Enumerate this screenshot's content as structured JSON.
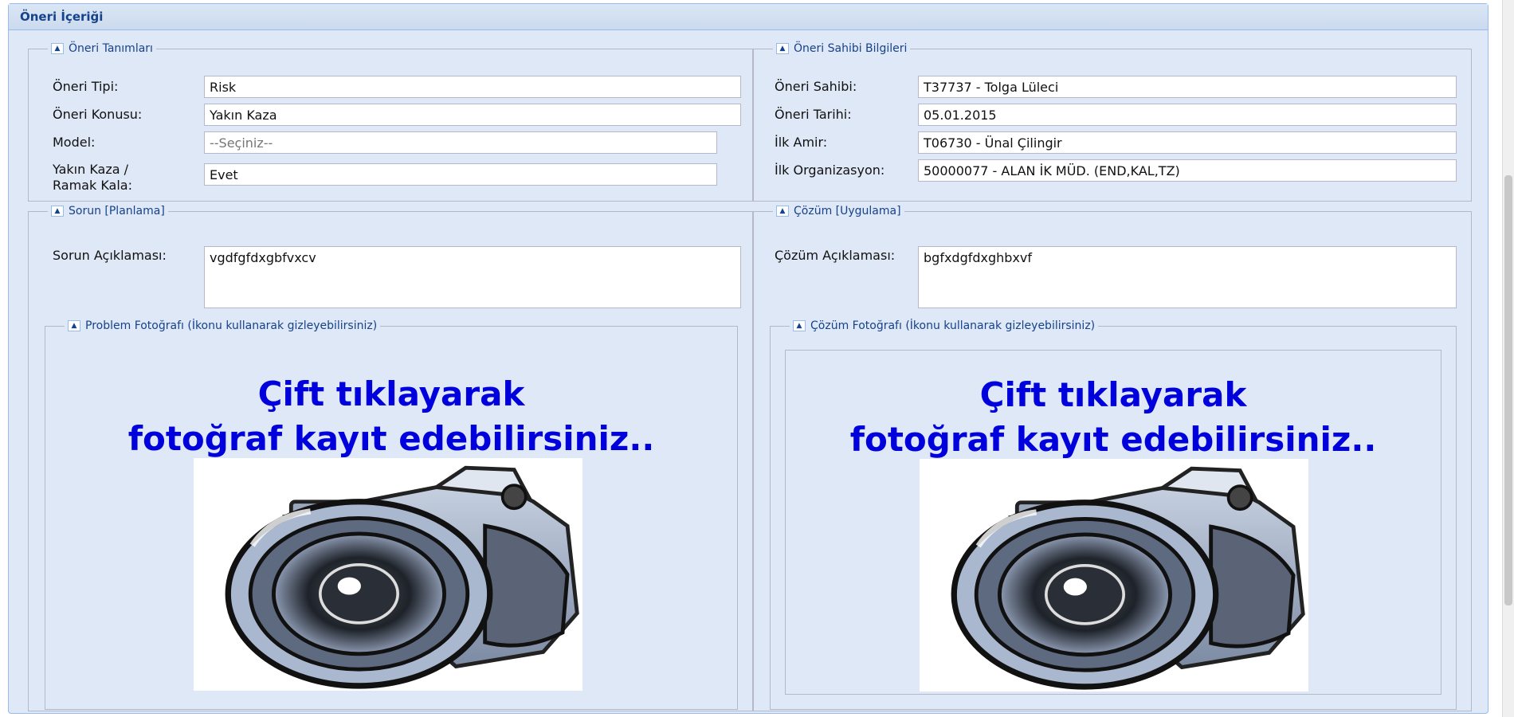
{
  "panel": {
    "title": "Öneri İçeriği"
  },
  "tanim": {
    "legend": "Öneri Tanımları",
    "tip_label": "Öneri Tipi:",
    "tip_value": "Risk",
    "konu_label": "Öneri Konusu:",
    "konu_value": "Yakın Kaza",
    "model_label": "Model:",
    "model_placeholder": "--Seçiniz--",
    "yakin_label_1": "Yakın Kaza /",
    "yakin_label_2": "Ramak Kala:",
    "yakin_value": "Evet"
  },
  "sahip": {
    "legend": "Öneri Sahibi Bilgileri",
    "sahibi_label": "Öneri Sahibi:",
    "sahibi_value": "T37737 - Tolga Lüleci",
    "tarih_label": "Öneri Tarihi:",
    "tarih_value": "05.01.2015",
    "amir_label": "İlk Amir:",
    "amir_value": "T06730 - Ünal Çilingir",
    "org_label": "İlk Organizasyon:",
    "org_value": "50000077 - ALAN İK MÜD. (END,KAL,TZ)"
  },
  "sorun": {
    "legend": "Sorun [Planlama]",
    "aciklama_label": "Sorun Açıklaması:",
    "aciklama_value": "vgdfgfdxgbfvxcv",
    "photo_legend": "Problem Fotoğrafı (İkonu kullanarak gizleyebilirsiniz)",
    "photo_text_1": "Çift tıklayarak",
    "photo_text_2": "fotoğraf kayıt edebilirsiniz.."
  },
  "cozum": {
    "legend": "Çözüm [Uygulama]",
    "aciklama_label": "Çözüm Açıklaması:",
    "aciklama_value": "bgfxdgfdxghbxvf",
    "photo_legend": "Çözüm Fotoğrafı (İkonu kullanarak gizleyebilirsiniz)",
    "photo_text_1": "Çift tıklayarak",
    "photo_text_2": "fotoğraf kayıt edebilirsiniz.."
  },
  "icons": {
    "collapse": "collapse-up-icon",
    "camera": "camera-icon"
  },
  "colors": {
    "accent": "#15428b",
    "panel_bg": "#dfe8f6",
    "border": "#99bbe8",
    "photo_text": "#0000dd"
  }
}
